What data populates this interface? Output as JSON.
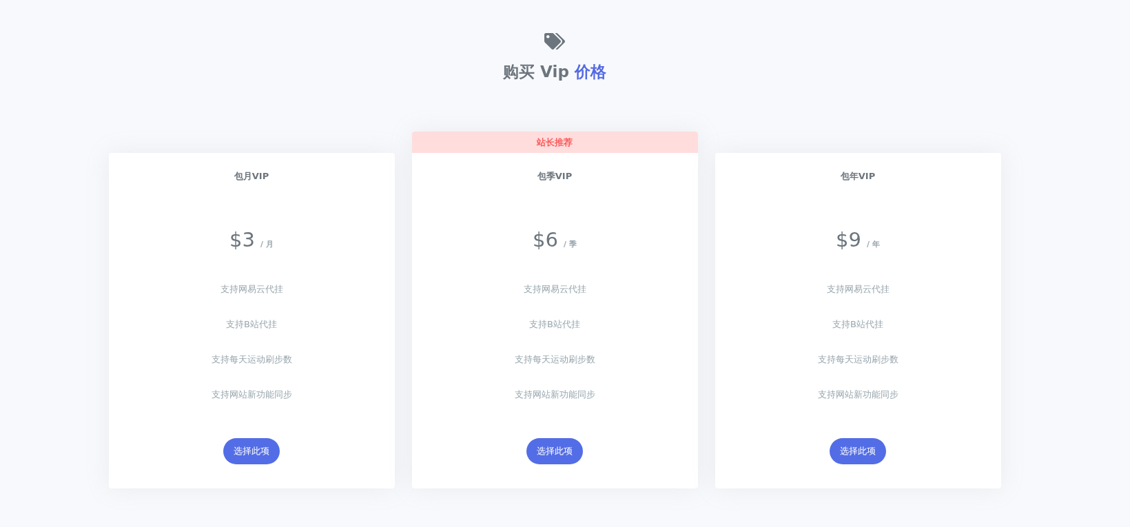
{
  "header": {
    "title": "购买 Vip",
    "title_highlight": "价格"
  },
  "plans": [
    {
      "name": "包月VIP",
      "price": "$3",
      "period": "/ 月",
      "features": [
        "支持网易云代挂",
        "支持B站代挂",
        "支持每天运动刷步数",
        "支持网站新功能同步"
      ],
      "button": "选择此项"
    },
    {
      "badge": "站长推荐",
      "name": "包季VIP",
      "price": "$6",
      "period": "/ 季",
      "features": [
        "支持网易云代挂",
        "支持B站代挂",
        "支持每天运动刷步数",
        "支持网站新功能同步"
      ],
      "button": "选择此项"
    },
    {
      "name": "包年VIP",
      "price": "$9",
      "period": "/ 年",
      "features": [
        "支持网易云代挂",
        "支持B站代挂",
        "支持每天运动刷步数",
        "支持网站新功能同步"
      ],
      "button": "选择此项"
    }
  ]
}
